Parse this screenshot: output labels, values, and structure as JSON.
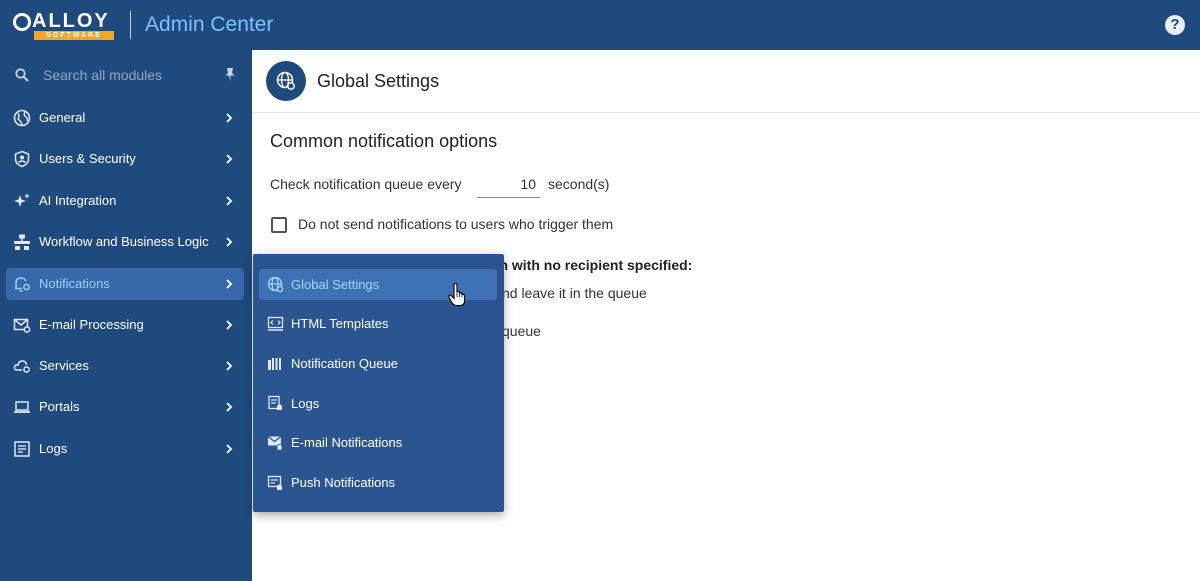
{
  "brand": {
    "logo_word": "ALLOY",
    "logo_sub": "SOFTWARE",
    "app_title": "Admin Center",
    "help_label": "?"
  },
  "sidebar": {
    "search_placeholder": "Search all modules",
    "items": [
      {
        "label": "General",
        "icon": "globe-icon"
      },
      {
        "label": "Users & Security",
        "icon": "shield-user-icon"
      },
      {
        "label": "AI Integration",
        "icon": "sparkles-icon"
      },
      {
        "label": "Workflow and Business Logic",
        "icon": "workflow-icon"
      },
      {
        "label": "Notifications",
        "icon": "bell-gear-icon",
        "active": true
      },
      {
        "label": "E-mail Processing",
        "icon": "mail-gear-icon"
      },
      {
        "label": "Services",
        "icon": "cloud-gear-icon"
      },
      {
        "label": "Portals",
        "icon": "laptop-icon"
      },
      {
        "label": "Logs",
        "icon": "log-icon"
      }
    ]
  },
  "flyout": {
    "items": [
      {
        "label": "Global Settings",
        "icon": "globe-gear-icon",
        "active": true
      },
      {
        "label": "HTML Templates",
        "icon": "html-template-icon"
      },
      {
        "label": "Notification Queue",
        "icon": "queue-icon"
      },
      {
        "label": "Logs",
        "icon": "log-bell-icon"
      },
      {
        "label": "E-mail Notifications",
        "icon": "mail-bell-icon"
      },
      {
        "label": "Push Notifications",
        "icon": "push-bell-icon"
      }
    ]
  },
  "page": {
    "title": "Global Settings",
    "section_title": "Common notification options",
    "queue_label": "Check notification queue every",
    "queue_value": "10",
    "queue_unit": "second(s)",
    "checkbox_label": "Do not send notifications to users who trigger them",
    "checkbox_checked": false,
    "subhead_visible": "ion with no recipient specified:",
    "option1_visible": "nd leave it in the queue",
    "option2_visible": "queue"
  },
  "colors": {
    "brand_navy": "#1f4a7e",
    "active_item": "#3769aa",
    "accent_blue": "#7fc1ff",
    "logo_orange": "#f5a623"
  }
}
